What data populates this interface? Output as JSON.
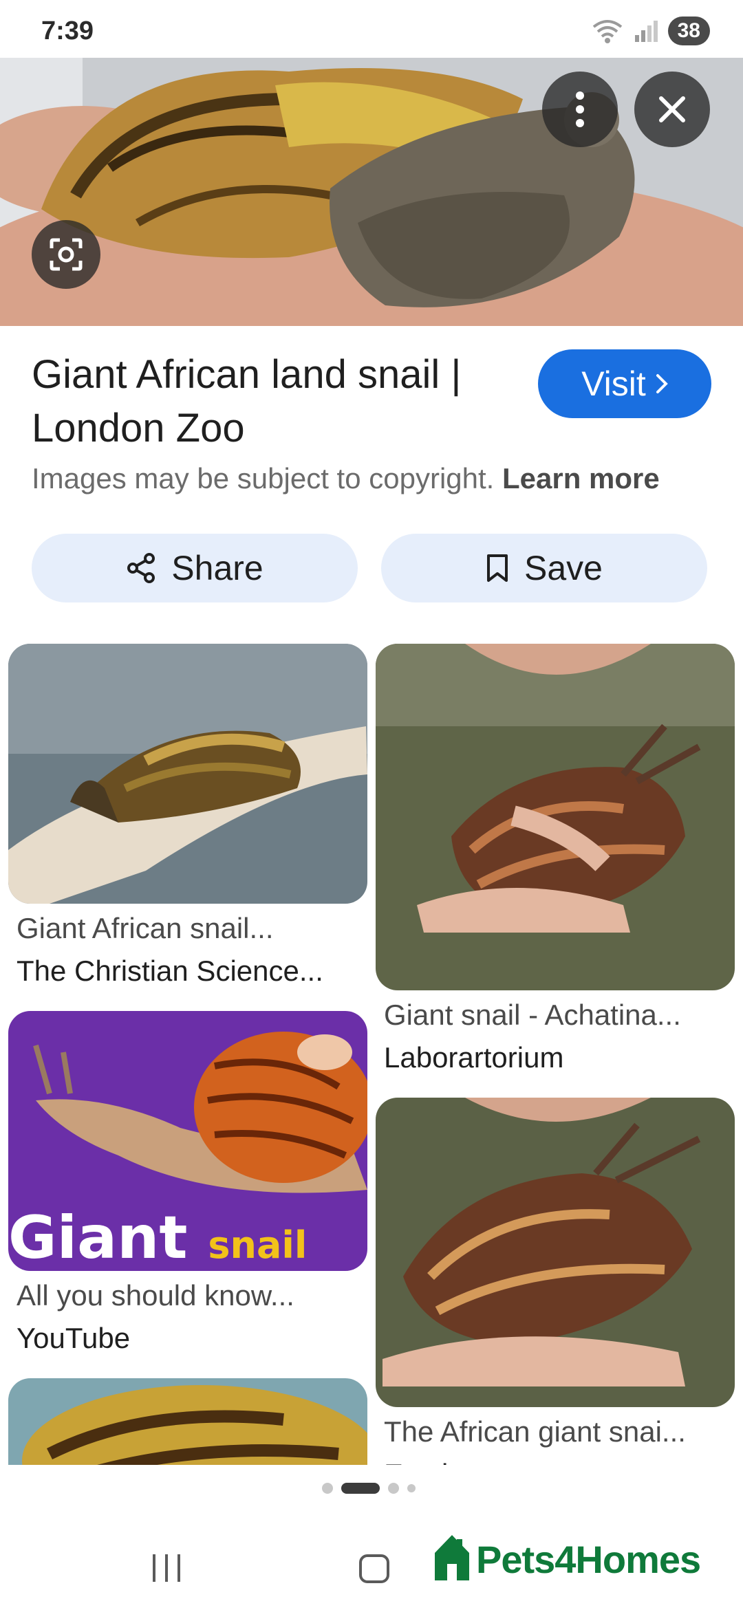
{
  "status": {
    "time": "7:39",
    "battery": "38"
  },
  "hero": {
    "menu_icon": "more-vert-icon",
    "close_icon": "close-icon",
    "lens_icon": "lens-icon"
  },
  "result": {
    "title_line1": "Giant African land snail |",
    "title_line2": "London Zoo",
    "visit_label": "Visit",
    "copyright_text": "Images may be subject to copyright.",
    "learn_more": "Learn more"
  },
  "actions": {
    "share_label": "Share",
    "save_label": "Save"
  },
  "grid": {
    "left": [
      {
        "title": "Giant African snail...",
        "source": "The Christian Science..."
      },
      {
        "title": "All you should know...",
        "source": "YouTube",
        "overlay_big": "Giant",
        "overlay_small": "snail"
      }
    ],
    "right": [
      {
        "title": "Giant snail - Achatina...",
        "source": "Laborartorium"
      },
      {
        "title": "The African giant snai...",
        "source": "Exoticpets"
      }
    ]
  },
  "ad": {
    "brand": "Pets4Homes"
  },
  "colors": {
    "accent": "#1a6fe0",
    "pill_bg": "#e6eefb",
    "ad_green": "#0f7a3a"
  }
}
